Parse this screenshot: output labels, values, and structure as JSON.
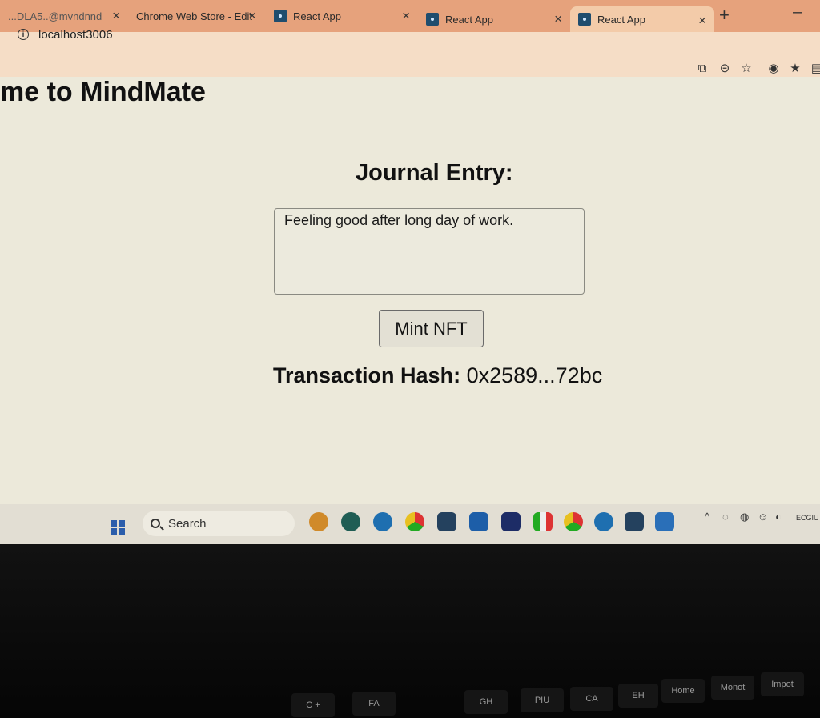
{
  "tabs": [
    {
      "label": "...DLA5..@mvndnnd",
      "active": false
    },
    {
      "label": "Chrome Web Store - Edit",
      "active": false
    },
    {
      "label": "React App",
      "active": false
    },
    {
      "label": "React App",
      "active": false
    },
    {
      "label": "React App",
      "active": true
    }
  ],
  "tab_close": "×",
  "new_tab": "+",
  "minimize": "–",
  "address": {
    "url": "localhost3006"
  },
  "page": {
    "welcome": "me to MindMate",
    "journal_title": "Journal Entry:",
    "entry_text": "Feeling good after long day of work.",
    "mint_label": "Mint NFT",
    "tx_label": "Transaction Hash:",
    "tx_value": "0x2589...72bc"
  },
  "taskbar": {
    "search_label": "Search",
    "clock": "ECGIU"
  },
  "keyboard": {
    "keys": [
      "Home",
      "Monot",
      "Impot",
      "C +",
      "GH",
      "FA",
      "PIU",
      "CA",
      "EH"
    ]
  },
  "colors": {
    "tabbar": "#e6a27c",
    "page_bg": "#ece9da",
    "accent_tab": "#1f4d6e"
  }
}
